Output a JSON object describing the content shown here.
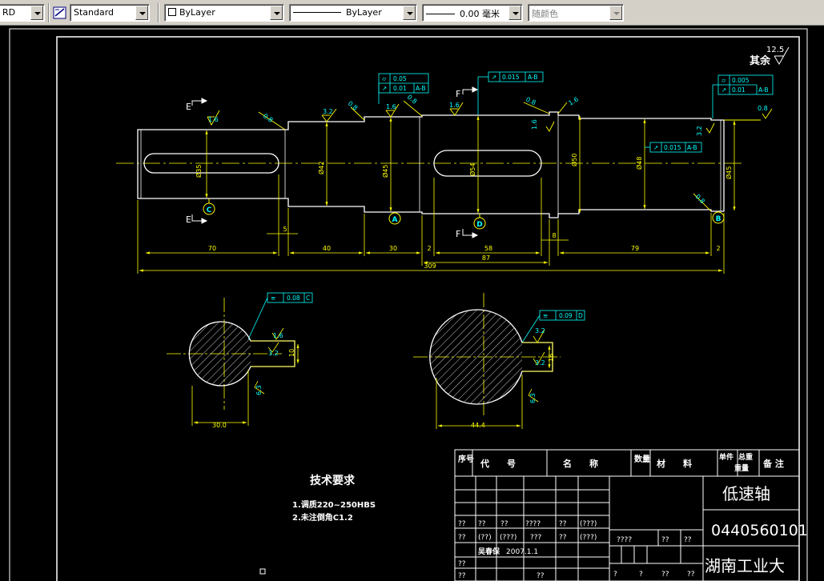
{
  "toolbar": {
    "text_style_partial": "RD",
    "dim_style": "Standard",
    "layer_color": "ByLayer",
    "linetype": "ByLayer",
    "lineweight": "0.00 毫米",
    "plot_style": "随颜色"
  },
  "colors": {
    "background": "#000000",
    "outline": "#ffffff",
    "dimension": "#ffff00",
    "annotation": "#00ffff",
    "toolbar": "#d4d0c8"
  },
  "drawing": {
    "roughness_note": "其余",
    "roughness_value": "12.5",
    "section_labels": {
      "e_top": "E",
      "e_bottom": "E",
      "f_top": "F",
      "f_bottom": "F"
    },
    "datums": [
      "C",
      "A",
      "D",
      "B"
    ],
    "tolerance_frames": {
      "frame_1_row1": "0.05",
      "frame_1_row2": "0.01",
      "frame_1_row2_ref": "A-B",
      "frame_2": "0.015",
      "frame_2_ref": "A-B",
      "frame_3_row1": "0.005",
      "frame_3_row2": "0.01",
      "frame_3_row2_ref": "A-B",
      "frame_4": "0.015",
      "frame_4_ref": "A-B",
      "section_e_frame": "0.08",
      "section_e_ref": "C",
      "section_f_frame": "0.09",
      "section_f_ref": "D"
    },
    "roughness_marks": [
      "1.6",
      "0.8",
      "3.2",
      "0.8",
      "1.6",
      "0.8",
      "1.6",
      "0.8",
      "1.6",
      "0.8",
      "1.6",
      "3.2",
      "0.8",
      "1.6",
      "3.2",
      "3.2",
      "6.3",
      "3.2",
      "3.2",
      "6.3"
    ],
    "diameters": [
      "Ø35",
      "Ø42",
      "Ø45",
      "Ø54",
      "Ø50",
      "Ø48",
      "Ø45"
    ],
    "lengths": {
      "seg1": "70",
      "gap1": "5",
      "seg2": "40",
      "seg3": "30",
      "gap2": "2",
      "seg4": "58",
      "seg4_total": "87",
      "gap3": "8",
      "seg5": "79",
      "gap4": "2",
      "total": "309"
    },
    "section_dims": {
      "e_width": "30.0",
      "e_key": "10",
      "f_width": "44.4",
      "f_key": "16"
    },
    "tech_requirements": {
      "title": "技术要求",
      "line1": "1.调质220~250HBS",
      "line2": "2.未注倒角C1.2"
    }
  },
  "title_block": {
    "header": {
      "seq": "序号",
      "code": "代　　号",
      "name": "名　　称",
      "qty": "数量",
      "material": "材　　料",
      "unit_weight": "单件",
      "total_weight": "总重",
      "weight": "重量",
      "remarks": "备 注"
    },
    "part_name": "低速轴",
    "drawing_number": "0440560101",
    "school": "湖南工业大",
    "row_a": [
      "??",
      "??",
      "??",
      "????",
      "??",
      "(???)"
    ],
    "row_b": [
      "??",
      "(??)",
      "(???)",
      "???",
      "??",
      "(???)"
    ],
    "row_b_right": [
      "????",
      "??",
      "??"
    ],
    "designer": "吴春保",
    "date": "2007.1.1",
    "row_c": [
      "??"
    ],
    "row_d": [
      "??",
      "??"
    ],
    "row_d_right": [
      "?",
      "?",
      "??",
      "??"
    ]
  }
}
